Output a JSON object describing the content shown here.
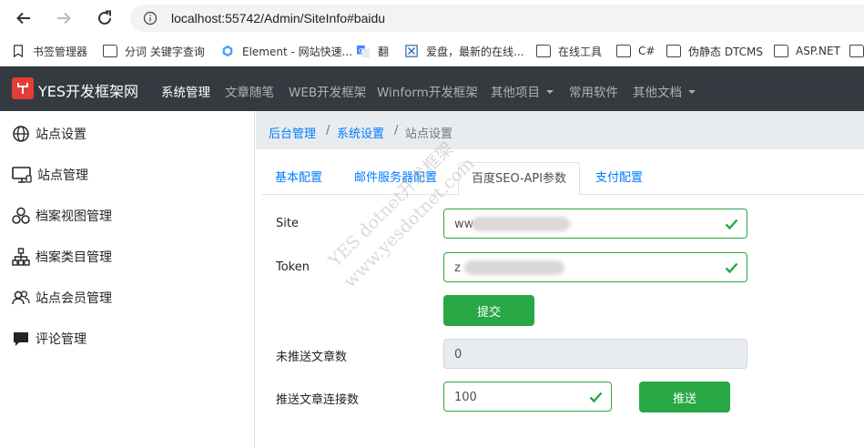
{
  "browser": {
    "url": "localhost:55742/Admin/SiteInfo#baidu",
    "bookmarks": [
      {
        "label": "书签管理器",
        "icon": "bookmark-manager-icon"
      },
      {
        "label": "分词 关键字查询",
        "icon": "folder-icon"
      },
      {
        "label": "Element - 网站快速...",
        "icon": "element-icon"
      },
      {
        "label": "翻",
        "icon": "google-translate-icon"
      },
      {
        "label": "爱盘，最新的在线...",
        "icon": "aipan-icon"
      },
      {
        "label": "在线工具",
        "icon": "folder-icon"
      },
      {
        "label": "C#",
        "icon": "folder-icon"
      },
      {
        "label": "伪静态 DTCMS",
        "icon": "folder-icon"
      },
      {
        "label": "ASP.NET",
        "icon": "folder-icon"
      }
    ]
  },
  "navbar": {
    "brand": "YES开发框架网",
    "links": [
      {
        "label": "系统管理",
        "active": true
      },
      {
        "label": "文章随笔"
      },
      {
        "label": "WEB开发框架"
      },
      {
        "label": "Winform开发框架"
      },
      {
        "label": "其他项目",
        "dropdown": true
      },
      {
        "label": "常用软件"
      },
      {
        "label": "其他文档",
        "dropdown": true
      }
    ]
  },
  "sidebar": {
    "items": [
      {
        "label": "站点设置",
        "icon": "globe-icon"
      },
      {
        "label": "站点管理",
        "icon": "monitor-icon"
      },
      {
        "label": "档案视图管理",
        "icon": "circles-icon"
      },
      {
        "label": "档案类目管理",
        "icon": "sitemap-icon"
      },
      {
        "label": "站点会员管理",
        "icon": "users-icon"
      },
      {
        "label": "评论管理",
        "icon": "comment-icon"
      }
    ]
  },
  "breadcrumb": {
    "items": [
      "后台管理",
      "系统设置",
      "站点设置"
    ],
    "separator": "/"
  },
  "tabs": [
    {
      "label": "基本配置"
    },
    {
      "label": "邮件服务器配置"
    },
    {
      "label": "百度SEO-API参数",
      "active": true
    },
    {
      "label": "支付配置"
    }
  ],
  "form": {
    "site_label": "Site",
    "site_value": "ww",
    "token_label": "Token",
    "token_value": "z",
    "submit_label": "提交",
    "unpushed_label": "未推送文章数",
    "unpushed_value": "0",
    "push_count_label": "推送文章连接数",
    "push_count_value": "100",
    "push_label": "推送"
  },
  "watermark": {
    "line1": "YES dotnet开发框架",
    "line2": "www.yesdotnet.com"
  },
  "colors": {
    "navbar_bg": "#343a40",
    "success": "#28a745",
    "link": "#007bff",
    "brand_red": "#e43d35"
  }
}
